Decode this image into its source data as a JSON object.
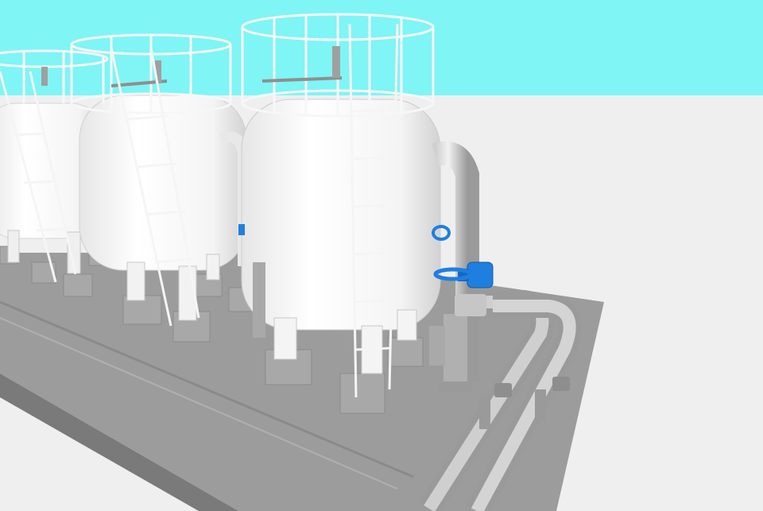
{
  "scene": {
    "description_visible_text": "",
    "colors": {
      "sky": "#7ff5f5",
      "ground": "#efefef",
      "skid_top": "#9a9a9a",
      "skid_side": "#7a7a7a",
      "tank": "#ffffff",
      "tank_shade": "#dcdcdc",
      "pipe": "#b9b9b9",
      "pipe_dark": "#8e8e8e",
      "valve_blue": "#1e7fe0",
      "footing": "#a6a6a6"
    },
    "objects": {
      "tanks": 3,
      "ladders": 3,
      "railings": 3,
      "blue_valves": 2
    }
  }
}
